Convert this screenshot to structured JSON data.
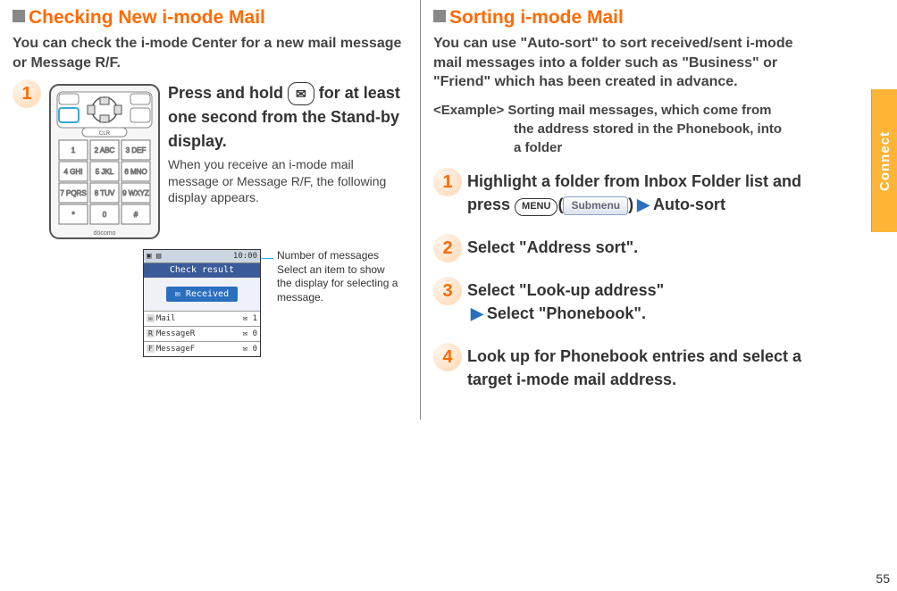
{
  "page_number": "55",
  "side_tab": "Connect",
  "left": {
    "heading": "Checking New i-mode Mail",
    "intro": "You can check the i-mode Center for a new mail message or Message R/F.",
    "step1_main": "Press and hold        for at least one second from the Stand-by display.",
    "step1_main_pre": "Press and hold ",
    "step1_main_post": " for at least one second from the Stand-by display.",
    "step1_sub": "When you receive an i-mode mail message or Message R/F, the following display appears.",
    "screen": {
      "status_left": "▣ ▤",
      "status_right": "10:00",
      "title": "Check result",
      "received": "✉ Received",
      "rows": [
        {
          "label": "✉",
          "name": "Mail",
          "count": "1"
        },
        {
          "label": "R",
          "name": "MessageR",
          "count": "0"
        },
        {
          "label": "F",
          "name": "MessageF",
          "count": "0"
        }
      ]
    },
    "annotation1": "Number of messages",
    "annotation2": "Select an item to show the display for selecting a message."
  },
  "right": {
    "heading": "Sorting i-mode Mail",
    "intro": "You can use \"Auto-sort\" to sort received/sent i-mode mail messages into a folder such as \"Business\" or \"Friend\" which has been created in advance.",
    "example_label": "<Example>",
    "example_text1": "Sorting mail messages, which come from",
    "example_text2": "the address stored in the Phonebook, into",
    "example_text3": "a folder",
    "step1_pre": "Highlight a folder from Inbox Folder list and press ",
    "step1_menu": "MENU",
    "step1_sub": "Submenu",
    "step1_post": "Auto-sort",
    "step2": "Select \"Address sort\".",
    "step3a": "Select \"Look-up address\"",
    "step3b": "Select \"Phonebook\".",
    "step4": "Look up for Phonebook entries and select a target i-mode mail address."
  }
}
